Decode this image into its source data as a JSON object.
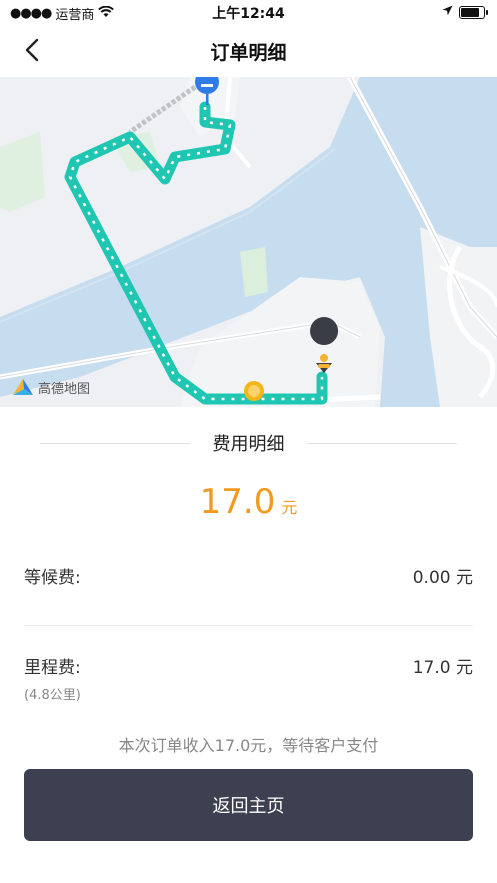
{
  "status_bar": {
    "carrier": "运营商",
    "time": "上午12:44"
  },
  "nav": {
    "title": "订单明细",
    "back_icon": "chevron-left-icon"
  },
  "map": {
    "provider_logo": "高德地图",
    "route_color": "#1fc6b2",
    "start_pin_color": "#2f7be8",
    "end_pin_color": "#3a3d46"
  },
  "fee_detail": {
    "title": "费用明细",
    "total_amount": "17.0",
    "total_unit": "元",
    "items": [
      {
        "label": "等候费:",
        "value": "0.00 元"
      },
      {
        "label": "里程费:",
        "value": "17.0 元",
        "note": "(4.8公里)"
      }
    ]
  },
  "income_note": "本次订单收入17.0元，等待客户支付",
  "home_button": "返回主页",
  "colors": {
    "accent": "#f29a1f",
    "button_bg": "#3d4050"
  }
}
